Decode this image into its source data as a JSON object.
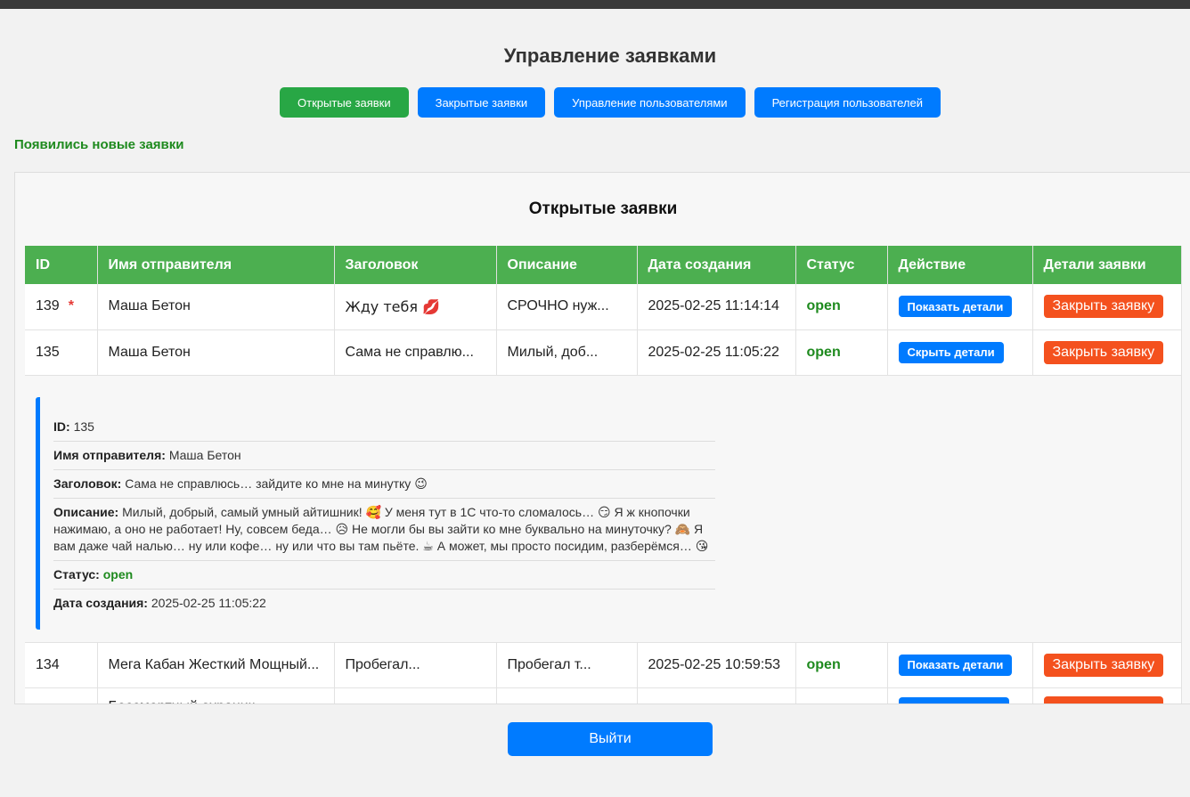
{
  "page_title": "Управление заявками",
  "nav": {
    "open": "Открытые заявки",
    "closed": "Закрытые заявки",
    "users": "Управление пользователями",
    "register": "Регистрация пользователей"
  },
  "notice": "Появились новые заявки",
  "panel_title": "Открытые заявки",
  "columns": [
    "ID",
    "Имя отправителя",
    "Заголовок",
    "Описание",
    "Дата создания",
    "Статус",
    "Действие",
    "Детали заявки"
  ],
  "rows": [
    {
      "id": "139",
      "new_marker": "*",
      "sender": "Маша Бетон",
      "title": "Жду тебя 💋",
      "description": "СРОЧНО нуж...",
      "created": "2025-02-25 11:14:14",
      "status": "open",
      "action": "Показать детали",
      "close": "Закрыть заявку"
    },
    {
      "id": "135",
      "sender": "Маша Бетон",
      "title": "Сама не справлю...",
      "description": "Милый, доб...",
      "created": "2025-02-25 11:05:22",
      "status": "open",
      "action": "Скрыть детали",
      "close": "Закрыть заявку"
    },
    {
      "id": "134",
      "sender": "Мега Кабан Жесткий Мощный...",
      "title": "Пробегал...",
      "description": "Пробегал т...",
      "created": "2025-02-25 10:59:53",
      "status": "open",
      "action": "Показать детали",
      "close": "Закрыть заявку"
    },
    {
      "id": "",
      "sender": "Бессмертный охраник",
      "title": "",
      "description": "",
      "created": "",
      "status": "",
      "action": "",
      "close": ""
    }
  ],
  "details": {
    "id_label": "ID:",
    "id": "135",
    "sender_label": "Имя отправителя:",
    "sender": "Маша Бетон",
    "title_label": "Заголовок:",
    "title": "Сама не справлюсь… зайдите ко мне на минутку 😉",
    "description_label": "Описание:",
    "description": "Милый, добрый, самый умный айтишник! 🥰 У меня тут в 1С что-то сломалось… 😏 Я ж кнопочки нажимаю, а оно не работает! Ну, совсем беда… 😥 Не могли бы вы зайти ко мне буквально на минуточку? 🙈 Я вам даже чай налью… ну или кофе… ну или что вы там пьёте. ☕ А может, мы просто посидим, разберёмся… 😘",
    "status_label": "Статус:",
    "status": "open",
    "created_label": "Дата создания:",
    "created": "2025-02-25 11:05:22"
  },
  "logout": "Выйти",
  "colors": {
    "green": "#4caf50",
    "blue": "#007bff",
    "red": "#f4511e",
    "status": "#1e8a1e"
  }
}
